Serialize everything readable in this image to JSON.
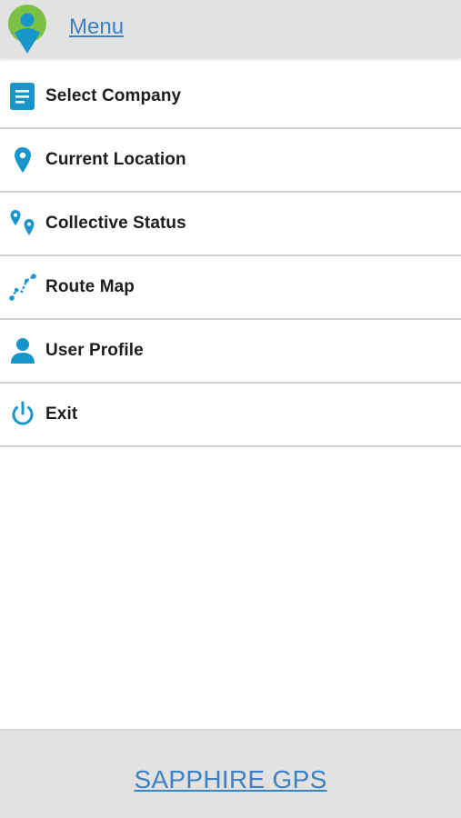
{
  "header": {
    "title": "Menu",
    "logo_icon": "location-person-logo-icon"
  },
  "menu": {
    "items": [
      {
        "label": "Select Company",
        "icon": "document-icon"
      },
      {
        "label": "Current Location",
        "icon": "map-pin-icon"
      },
      {
        "label": "Collective Status",
        "icon": "multiple-pins-icon"
      },
      {
        "label": "Route Map",
        "icon": "route-icon"
      },
      {
        "label": "User Profile",
        "icon": "user-icon"
      },
      {
        "label": "Exit",
        "icon": "power-icon"
      }
    ]
  },
  "footer": {
    "brand": "SAPPHIRE GPS"
  },
  "colors": {
    "accent": "#1896cc",
    "link": "#3a82c4",
    "header_bg": "#e2e2e2",
    "logo_green": "#7cc143"
  }
}
